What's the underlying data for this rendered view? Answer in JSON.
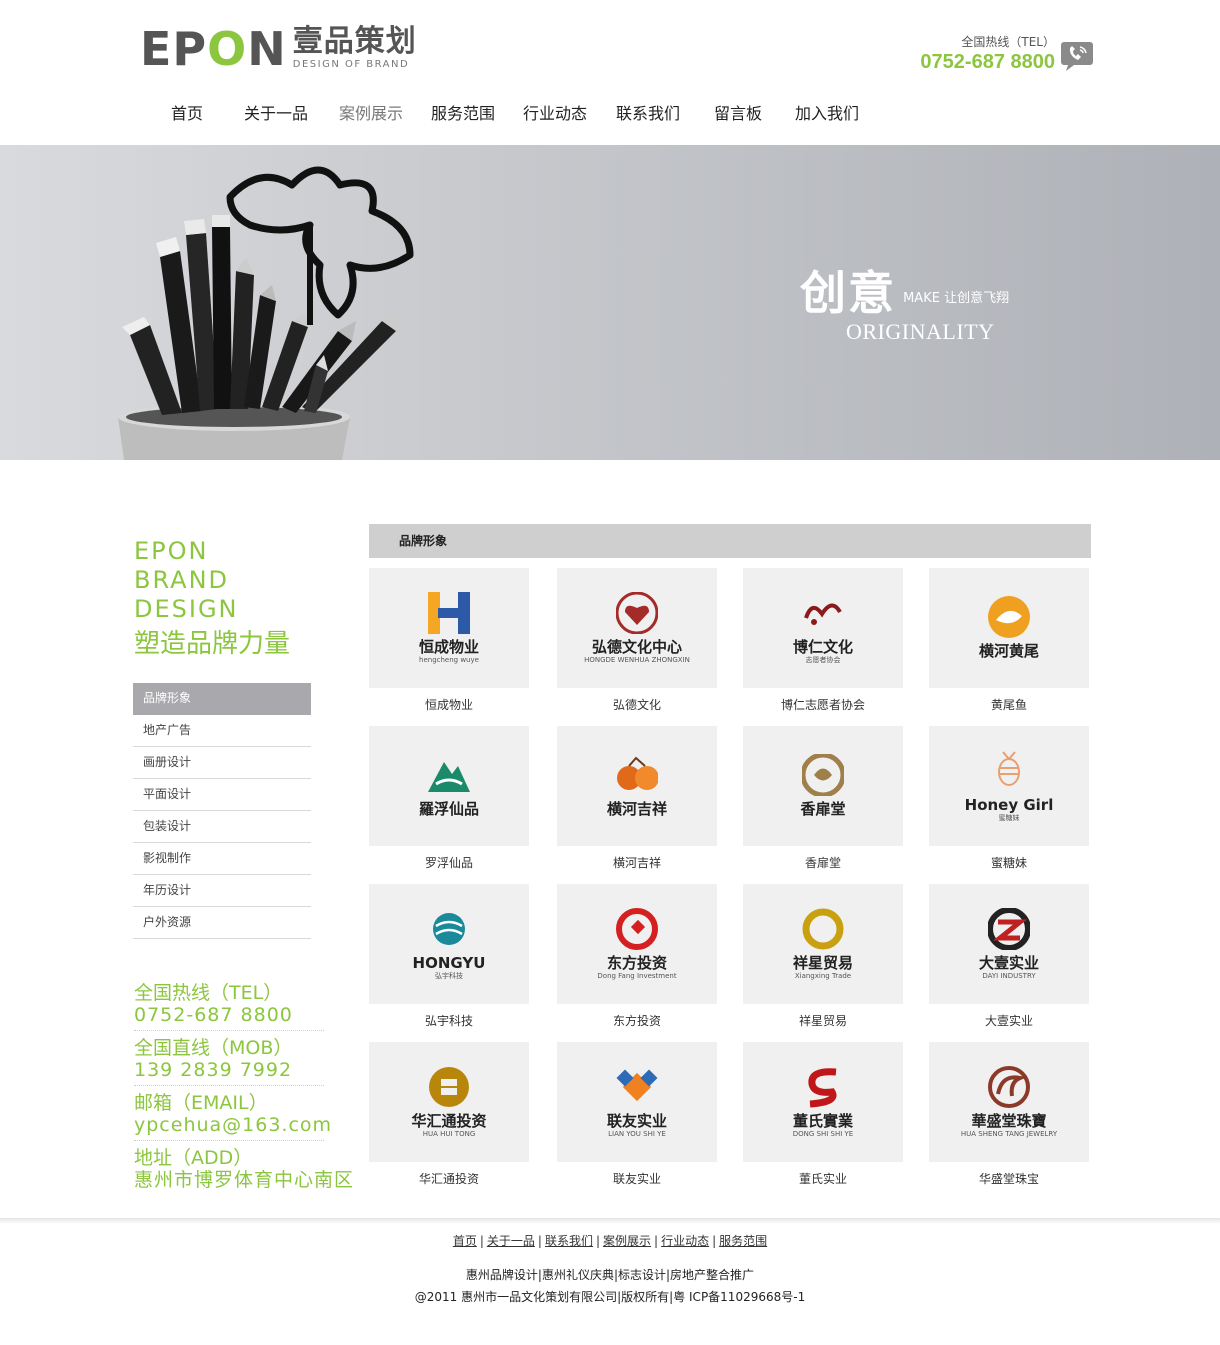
{
  "header": {
    "logo_en": "EPON",
    "logo_cn": "壹品策划",
    "logo_sub": "DESIGN OF BRAND",
    "hotline_label": "全国热线（TEL）",
    "hotline_number": "0752-687 8800"
  },
  "nav": {
    "items": [
      {
        "label": "首页"
      },
      {
        "label": "关于一品"
      },
      {
        "label": "案例展示"
      },
      {
        "label": "服务范围"
      },
      {
        "label": "行业动态"
      },
      {
        "label": "联系我们"
      },
      {
        "label": "留言板"
      },
      {
        "label": "加入我们"
      }
    ],
    "active": "案例展示"
  },
  "banner": {
    "title_cn": "创意",
    "make_text": "MAKE 让创意飞翔",
    "title_en": "ORIGINALITY"
  },
  "sidebar": {
    "slogan_en": [
      "EPON",
      "BRAND",
      "DESIGN"
    ],
    "slogan_cn": "塑造品牌力量",
    "menu": [
      {
        "label": "品牌形象"
      },
      {
        "label": "地产广告"
      },
      {
        "label": "画册设计"
      },
      {
        "label": "平面设计"
      },
      {
        "label": "包装设计"
      },
      {
        "label": "影视制作"
      },
      {
        "label": "年历设计"
      },
      {
        "label": "户外资源"
      }
    ],
    "active_menu": "品牌形象",
    "contact": [
      {
        "label": "全国热线（TEL）",
        "value": "0752-687 8800"
      },
      {
        "label": "全国直线（MOB）",
        "value": "139 2839 7992"
      },
      {
        "label": "邮箱（EMAIL）",
        "value": "ypcehua@163.com"
      },
      {
        "label": "地址（ADD）",
        "value": "惠州市博罗体育中心南区"
      }
    ]
  },
  "main": {
    "section_title": "品牌形象",
    "cases": [
      {
        "caption": "恒成物业",
        "logo_text": "恒成物业",
        "logo_sub": "hengcheng wuye",
        "icon": "hengcheng-logo-icon",
        "color": "#2d5aa8"
      },
      {
        "caption": "弘德文化",
        "logo_text": "弘德文化中心",
        "logo_sub": "HONGDE WENHUA ZHONGXIN",
        "icon": "hongde-logo-icon",
        "color": "#a52a2a"
      },
      {
        "caption": "博仁志愿者协会",
        "logo_text": "博仁文化",
        "logo_sub": "志愿者协会",
        "icon": "boren-logo-icon",
        "color": "#8b1a1a"
      },
      {
        "caption": "黄尾鱼",
        "logo_text": "横河黄尾",
        "logo_sub": "",
        "icon": "fish-logo-icon",
        "color": "#f0a020"
      },
      {
        "caption": "罗浮仙品",
        "logo_text": "羅浮仙品",
        "logo_sub": "",
        "icon": "mountain-logo-icon",
        "color": "#1a8a6a"
      },
      {
        "caption": "横河吉祥",
        "logo_text": "横河吉祥",
        "logo_sub": "",
        "icon": "orange-logo-icon",
        "color": "#e06a1a"
      },
      {
        "caption": "香扉堂",
        "logo_text": "香扉堂",
        "logo_sub": "",
        "icon": "swirl-logo-icon",
        "color": "#a0804a"
      },
      {
        "caption": "蜜糖妹",
        "logo_text": "Honey Girl",
        "logo_sub": "蜜糖妹",
        "icon": "bee-logo-icon",
        "color": "#e8a070"
      },
      {
        "caption": "弘宇科技",
        "logo_text": "HONGYU",
        "logo_sub": "弘宇科技",
        "icon": "globe-logo-icon",
        "color": "#1a8a9a"
      },
      {
        "caption": "东方投资",
        "logo_text": "东方投资",
        "logo_sub": "Dong Fang Investment",
        "icon": "circle-logo-icon",
        "color": "#d42020"
      },
      {
        "caption": "祥星贸易",
        "logo_text": "祥星贸易",
        "logo_sub": "Xiangxing Trade",
        "icon": "ring-logo-icon",
        "color": "#c8a010"
      },
      {
        "caption": "大壹实业",
        "logo_text": "大壹实业",
        "logo_sub": "DAYI INDUSTRY",
        "icon": "dayi-logo-icon",
        "color": "#c02020"
      },
      {
        "caption": "华汇通投资",
        "logo_text": "华汇通投资",
        "logo_sub": "HUA HUI TONG",
        "icon": "coin-logo-icon",
        "color": "#b8860b"
      },
      {
        "caption": "联友实业",
        "logo_text": "联友实业",
        "logo_sub": "LIAN YOU SHI YE",
        "icon": "diamond-logo-icon",
        "color": "#f08020"
      },
      {
        "caption": "董氏实业",
        "logo_text": "董氏實業",
        "logo_sub": "DONG SHI SHI YE",
        "icon": "s-logo-icon",
        "color": "#c01818"
      },
      {
        "caption": "华盛堂珠宝",
        "logo_text": "華盛堂珠寶",
        "logo_sub": "HUA SHENG TANG JEWELRY",
        "icon": "phoenix-logo-icon",
        "color": "#8b3a2a"
      }
    ]
  },
  "footer": {
    "links": [
      "首页",
      "关于一品",
      "联系我们",
      "案例展示",
      "行业动态",
      "服务范围"
    ],
    "seo_text": "惠州品牌设计|惠州礼仪庆典|标志设计|房地产整合推广",
    "copyright": "@2011 惠州市一品文化策划有限公司|版权所有|粤 ICP备11029668号-1"
  }
}
